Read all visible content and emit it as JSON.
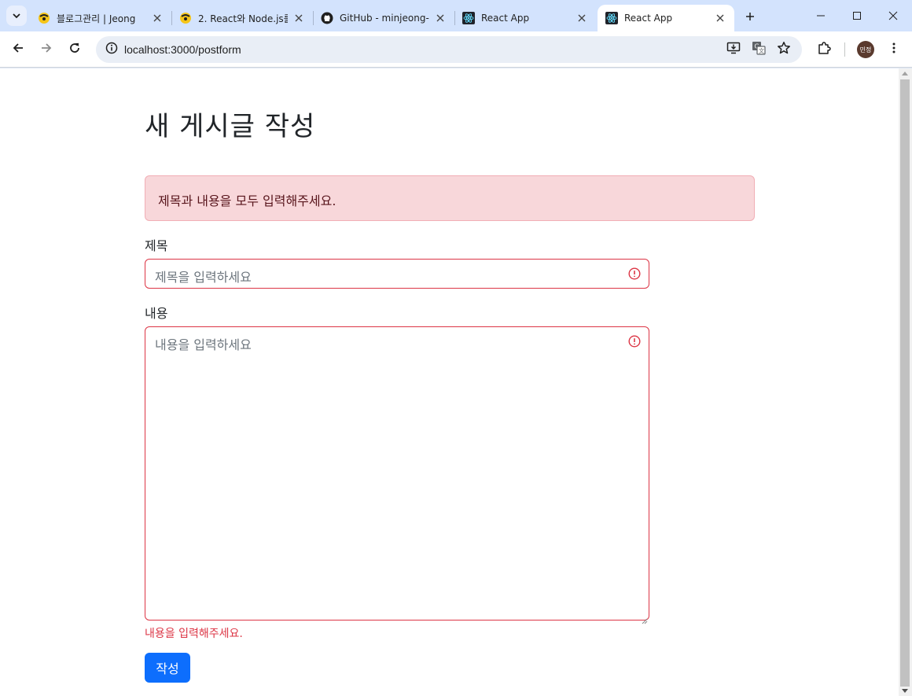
{
  "browser": {
    "tabs": [
      {
        "title": "블로그관리 | Jeong",
        "favicon": "bee-logo-icon",
        "active": false
      },
      {
        "title": "2. React와 Node.js를",
        "favicon": "bee-logo-icon",
        "active": false
      },
      {
        "title": "GitHub - minjeong-",
        "favicon": "github-icon",
        "active": false
      },
      {
        "title": "React App",
        "favicon": "react-icon",
        "active": false
      },
      {
        "title": "React App",
        "favicon": "react-icon",
        "active": true
      }
    ],
    "url": "localhost:3000/postform",
    "profile_initials": "민정"
  },
  "form": {
    "heading": "새 게시글 작성",
    "alert_message": "제목과 내용을 모두 입력해주세요.",
    "title_label": "제목",
    "title_placeholder": "제목을 입력하세요",
    "title_value": "",
    "content_label": "내용",
    "content_placeholder": "내용을 입력하세요",
    "content_value": "",
    "content_feedback": "내용을 입력해주세요.",
    "submit_label": "작성"
  },
  "colors": {
    "danger": "#dc3545",
    "alert_bg": "#f8d7da",
    "primary": "#0d6efd"
  }
}
